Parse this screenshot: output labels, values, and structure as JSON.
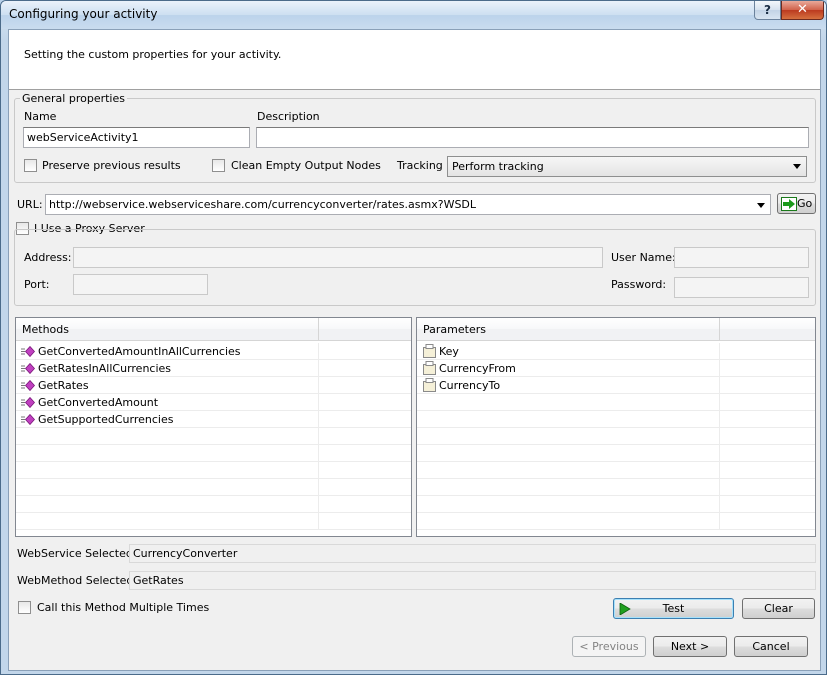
{
  "window": {
    "title": "Configuring your activity"
  },
  "header": {
    "text": "Setting the custom properties for your activity."
  },
  "general": {
    "caption": "General properties",
    "name_label": "Name",
    "name_value": "webServiceActivity1",
    "description_label": "Description",
    "description_value": "",
    "preserve_label": "Preserve previous results",
    "clean_label": "Clean Empty Output Nodes",
    "tracking_label": "Tracking",
    "tracking_value": "Perform tracking"
  },
  "url": {
    "label": "URL:",
    "value": "http://webservice.webserviceshare.com/currencyconverter/rates.asmx?WSDL",
    "go_label": "Go"
  },
  "proxy": {
    "checkbox_label": "I Use a Proxy Server",
    "address_label": "Address:",
    "port_label": "Port:",
    "user_label": "User Name:",
    "password_label": "Password:"
  },
  "methods": {
    "header": "Methods",
    "items": [
      "GetConvertedAmountInAllCurrencies",
      "GetRatesInAllCurrencies",
      "GetRates",
      "GetConvertedAmount",
      "GetSupportedCurrencies"
    ]
  },
  "parameters": {
    "header": "Parameters",
    "items": [
      "Key",
      "CurrencyFrom",
      "CurrencyTo"
    ]
  },
  "selection": {
    "webservice_label": "WebService Selected:",
    "webservice_value": "CurrencyConverter",
    "webmethod_label": "WebMethod Selected:",
    "webmethod_value": "GetRates"
  },
  "footer": {
    "multiple_label": "Call this Method Multiple Times",
    "test_label": "Test",
    "clear_label": "Clear",
    "previous_label": "< Previous",
    "next_label": "Next >",
    "cancel_label": "Cancel"
  },
  "icons": {
    "help": "help-icon",
    "close": "close-icon",
    "go": "go-arrow-icon",
    "test": "play-icon",
    "method": "method-icon",
    "parameter": "parameter-icon"
  },
  "colors": {
    "method_icon": "#c040c0",
    "go_arrow": "#1a9a1a",
    "play": "#20a020"
  }
}
